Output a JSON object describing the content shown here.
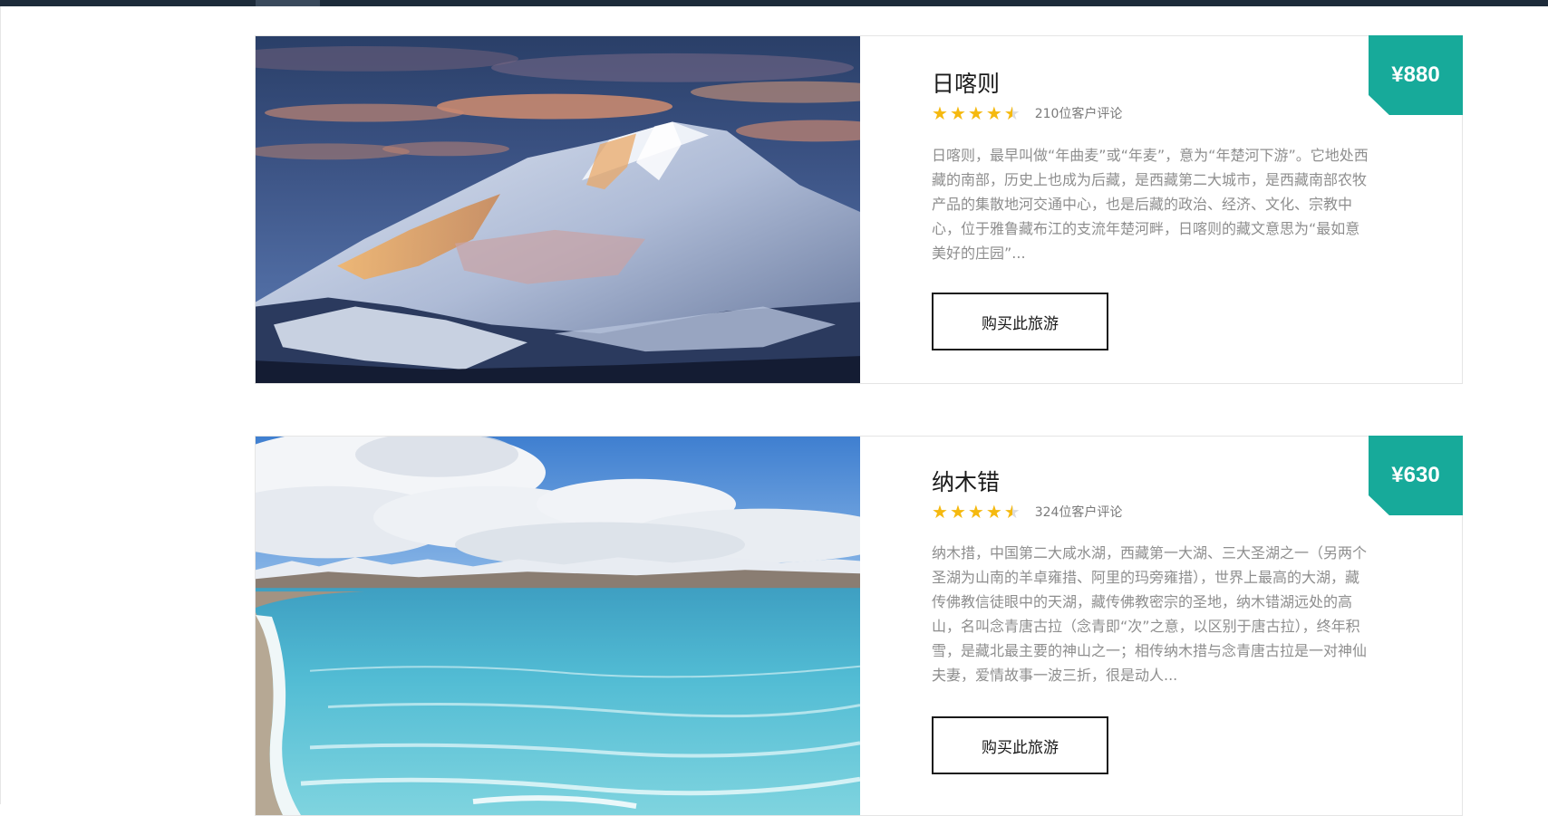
{
  "accent_color": "#17aa9a",
  "star_color": "#f5b90f",
  "tours": [
    {
      "title": "日喀则",
      "price": "¥880",
      "rating": 4.5,
      "reviews": "210位客户评论",
      "description": "日喀则，最早叫做“年曲麦”或“年麦”，意为“年楚河下游”。它地处西藏的南部，历史上也成为后藏，是西藏第二大城市，是西藏南部农牧产品的集散地河交通中心，也是后藏的政治、经济、文化、宗教中心，位于雅鲁藏布江的支流年楚河畔，日喀则的藏文意思为“最如意美好的庄园”...",
      "button": "购买此旅游",
      "image": "snow-mountain-photo"
    },
    {
      "title": "纳木错",
      "price": "¥630",
      "rating": 4.5,
      "reviews": "324位客户评论",
      "description": "纳木措，中国第二大咸水湖，西藏第一大湖、三大圣湖之一（另两个圣湖为山南的羊卓雍措、阿里的玛旁雍措），世界上最高的大湖，藏传佛教信徒眼中的天湖，藏传佛教密宗的圣地，纳木错湖远处的高山，名叫念青唐古拉（念青即“次”之意，以区别于唐古拉），终年积雪，是藏北最主要的神山之一；相传纳木措与念青唐古拉是一对神仙夫妻，爱情故事一波三折，很是动人...",
      "button": "购买此旅游",
      "image": "lake-photo"
    }
  ]
}
